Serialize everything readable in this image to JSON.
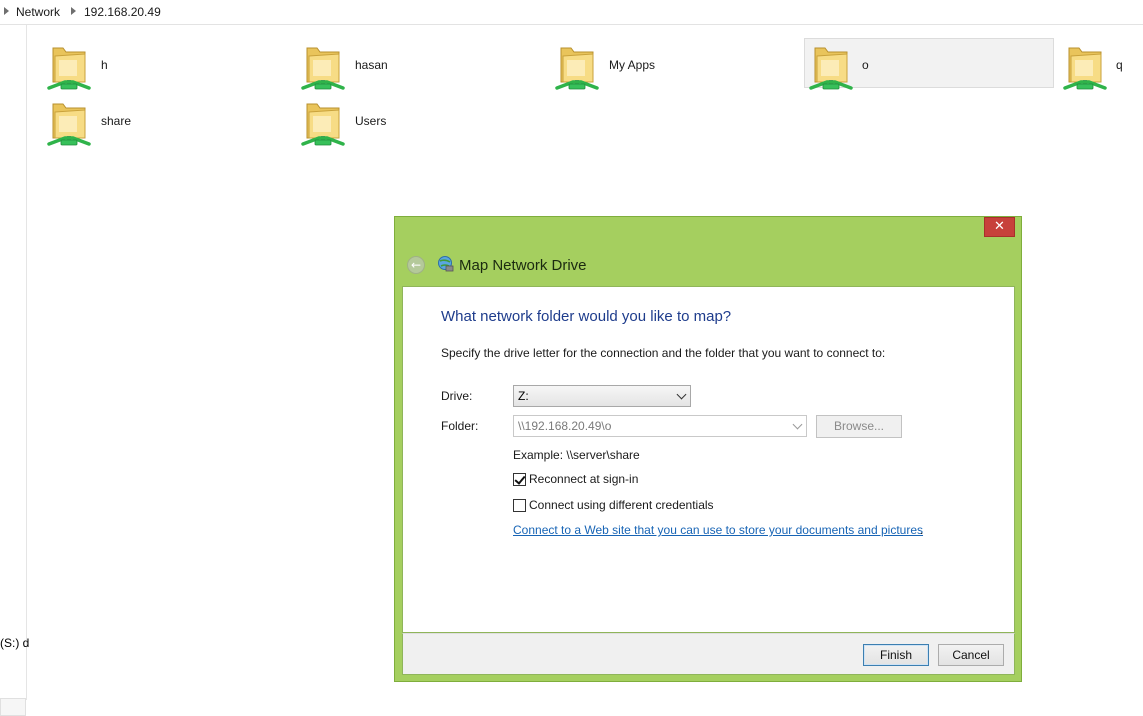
{
  "breadcrumb": {
    "items": [
      "Network",
      "192.168.20.49"
    ]
  },
  "folders": [
    {
      "name": "h",
      "selected": false
    },
    {
      "name": "hasan",
      "selected": false
    },
    {
      "name": "My Apps",
      "selected": false
    },
    {
      "name": "o",
      "selected": true
    },
    {
      "name": "q",
      "selected": false
    },
    {
      "name": "share",
      "selected": false
    },
    {
      "name": "Users",
      "selected": false
    }
  ],
  "leftpane": {
    "drive_label": "(S:) d"
  },
  "dialog": {
    "title": "Map Network Drive",
    "close_glyph": "✕",
    "back_glyph": "←",
    "heading": "What network folder would you like to map?",
    "instructions": "Specify the drive letter for the connection and the folder that you want to connect to:",
    "drive_label": "Drive:",
    "drive_value": "Z:",
    "folder_label": "Folder:",
    "folder_value": "\\\\192.168.20.49\\o",
    "browse_label": "Browse...",
    "example": "Example: \\\\server\\share",
    "reconnect_label": "Reconnect at sign-in",
    "reconnect_checked": true,
    "credentials_label": "Connect using different credentials",
    "credentials_checked": false,
    "web_link": "Connect to a Web site that you can use to store your documents and pictures",
    "web_link_suffix": ".",
    "finish_label": "Finish",
    "cancel_label": "Cancel"
  },
  "colors": {
    "dialog_frame": "#a5cf5f",
    "heading": "#1e3c8c",
    "link": "#1764b5",
    "close_button": "#c7413b"
  },
  "icons": {
    "folder": "network-folder-icon",
    "dialog": "map-network-drive-icon",
    "back": "back-arrow-icon",
    "close": "close-icon",
    "breadcrumb_separator": "chevron-right-icon"
  }
}
